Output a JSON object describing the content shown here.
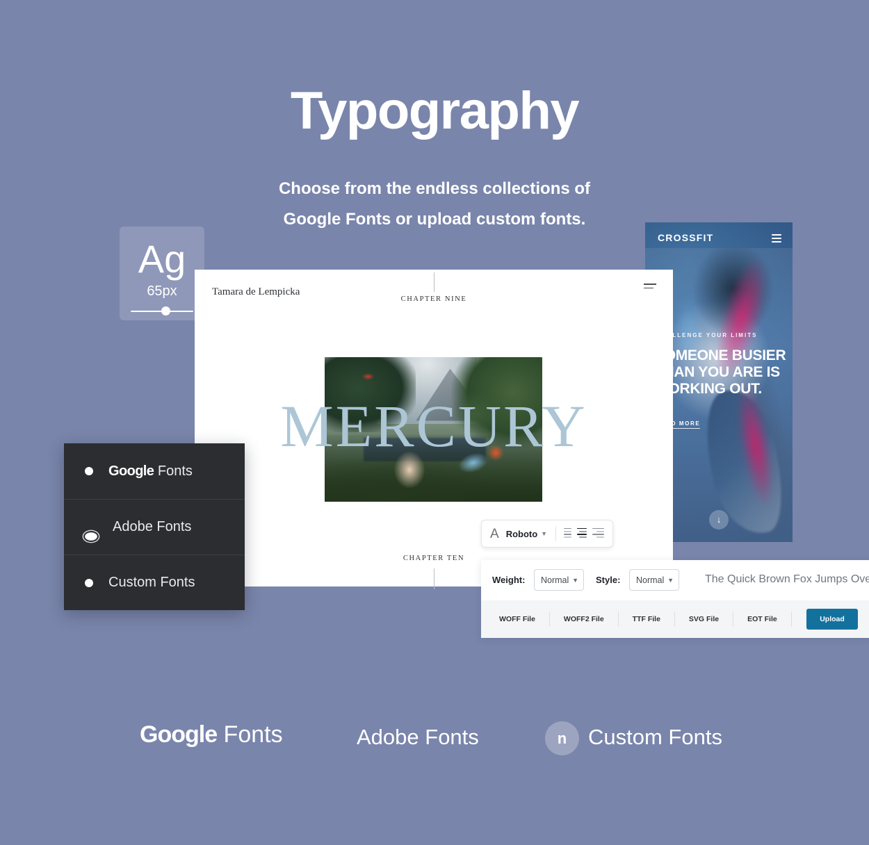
{
  "theme": {
    "background": "#7a85ab",
    "accent_upload": "#13719e",
    "menu_background": "#2b2d30",
    "mercury_color": "#adc6d6"
  },
  "hero": {
    "title": "Typography",
    "subtitle_line1": "Choose from the endless collections of",
    "subtitle_line2": "Google Fonts or upload custom fonts."
  },
  "size_card": {
    "glyph": "Ag",
    "size_label": "65px",
    "slider_value_percent": 58
  },
  "crossfit_mockup": {
    "brand": "CROSSFIT",
    "menu_icon": "hamburger-icon",
    "eyebrow": "CHALLENGE YOUR LIMITS",
    "headline": "SOMEONE BUSIER THAN YOU ARE IS WORKING OUT.",
    "cta": "READ MORE",
    "scroll_icon": "arrow-down-icon"
  },
  "book_mockup": {
    "author": "Tamara de Lempicka",
    "chapter_top": "CHAPTER NINE",
    "word": "MERCURY",
    "chapter_bottom": "CHAPTER TEN",
    "menu_icon": "hamburger-icon"
  },
  "font_toolbar": {
    "type_icon": "A",
    "font_name": "Roboto",
    "chevron_icon": "chevron-down-icon",
    "alignments": [
      {
        "name": "align-left-icon",
        "active": false
      },
      {
        "name": "align-center-icon",
        "active": true
      },
      {
        "name": "align-right-icon",
        "active": false
      }
    ]
  },
  "settings_panel": {
    "weight_label": "Weight:",
    "weight_value": "Normal",
    "style_label": "Style:",
    "style_value": "Normal",
    "preview_text": "The Quick Brown Fox Jumps Over The",
    "file_types": [
      "WOFF File",
      "WOFF2 File",
      "TTF File",
      "SVG File",
      "EOT File"
    ],
    "upload_label": "Upload"
  },
  "source_menu": {
    "items": [
      {
        "label_bold": "Google",
        "label_light": " Fonts",
        "selected": false
      },
      {
        "label_bold": "",
        "label_light": "Adobe Fonts",
        "selected": true
      },
      {
        "label_bold": "",
        "label_light": "Custom Fonts",
        "selected": false
      }
    ]
  },
  "logos": {
    "google_bold": "Google",
    "google_light": " Fonts",
    "adobe": "Adobe Fonts",
    "custom": "Custom Fonts",
    "custom_badge": "n"
  }
}
